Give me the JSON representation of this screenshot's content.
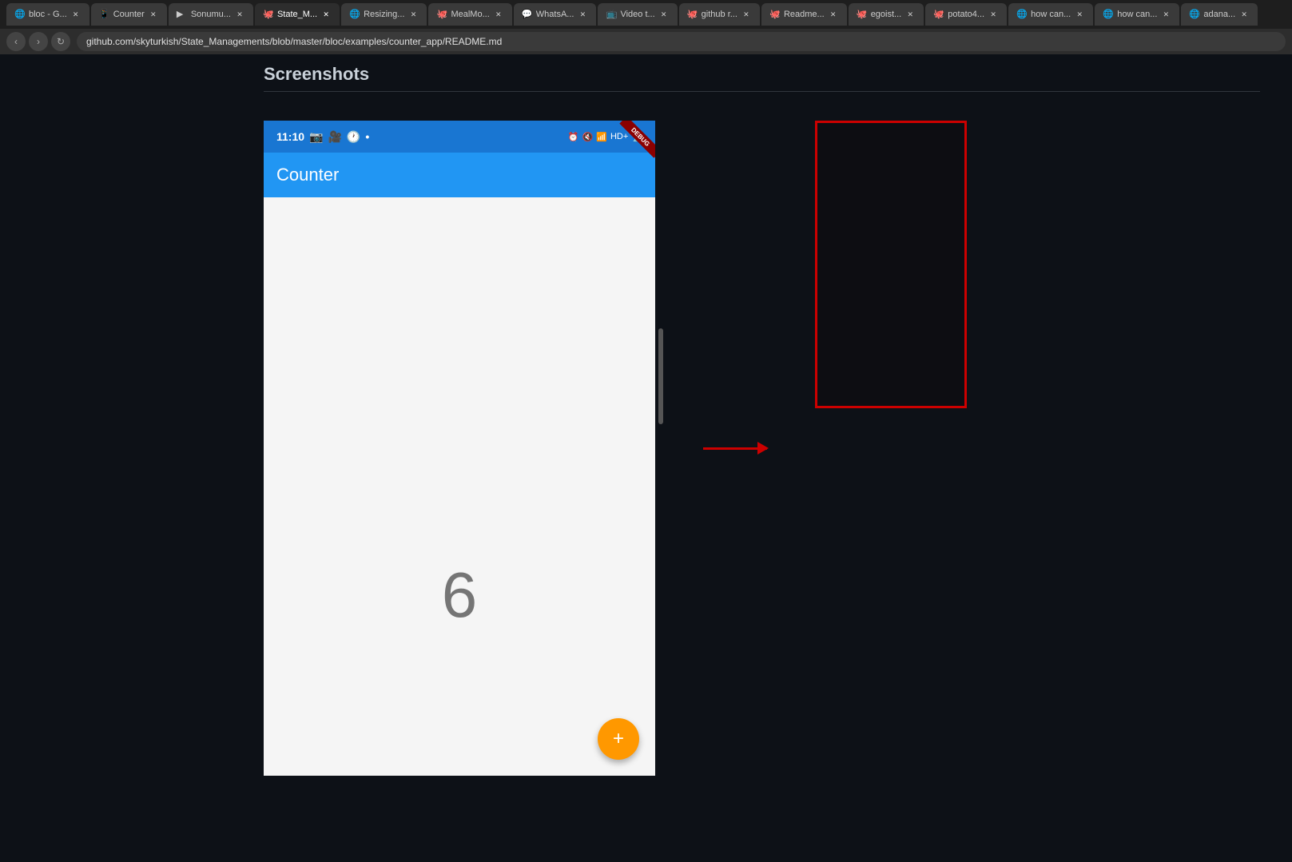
{
  "browser": {
    "tabs": [
      {
        "label": "bloc - G...",
        "active": false,
        "favicon": "🌐"
      },
      {
        "label": "Counter",
        "active": false,
        "favicon": "📱"
      },
      {
        "label": "Sonumu...",
        "active": false,
        "favicon": "▶"
      },
      {
        "label": "State_M...",
        "active": true,
        "favicon": "🐙"
      },
      {
        "label": "Resizing...",
        "active": false,
        "favicon": "🌐"
      },
      {
        "label": "MealMo...",
        "active": false,
        "favicon": "🐙"
      },
      {
        "label": "WhatsA...",
        "active": false,
        "favicon": "💬"
      },
      {
        "label": "Video t...",
        "active": false,
        "favicon": "📺"
      },
      {
        "label": "github r...",
        "active": false,
        "favicon": "🐙"
      },
      {
        "label": "Readme...",
        "active": false,
        "favicon": "🐙"
      },
      {
        "label": "egoist ...",
        "active": false,
        "favicon": "🐙"
      },
      {
        "label": "potato4...",
        "active": false,
        "favicon": "🐙"
      },
      {
        "label": "how can...",
        "active": false,
        "favicon": "🌐"
      },
      {
        "label": "how can...",
        "active": false,
        "favicon": "🌐"
      },
      {
        "label": "adana...",
        "active": false,
        "favicon": "🌐"
      }
    ],
    "url": "github.com/skyturkish/State_Managements/blob/master/bloc/examples/counter_app/README.md"
  },
  "page": {
    "screenshots_heading": "Screenshots"
  },
  "phone": {
    "status_time": "11:10",
    "app_title": "Counter",
    "counter_value": "6",
    "debug_label": "DEBUG"
  },
  "arrow": {
    "direction": "right"
  }
}
